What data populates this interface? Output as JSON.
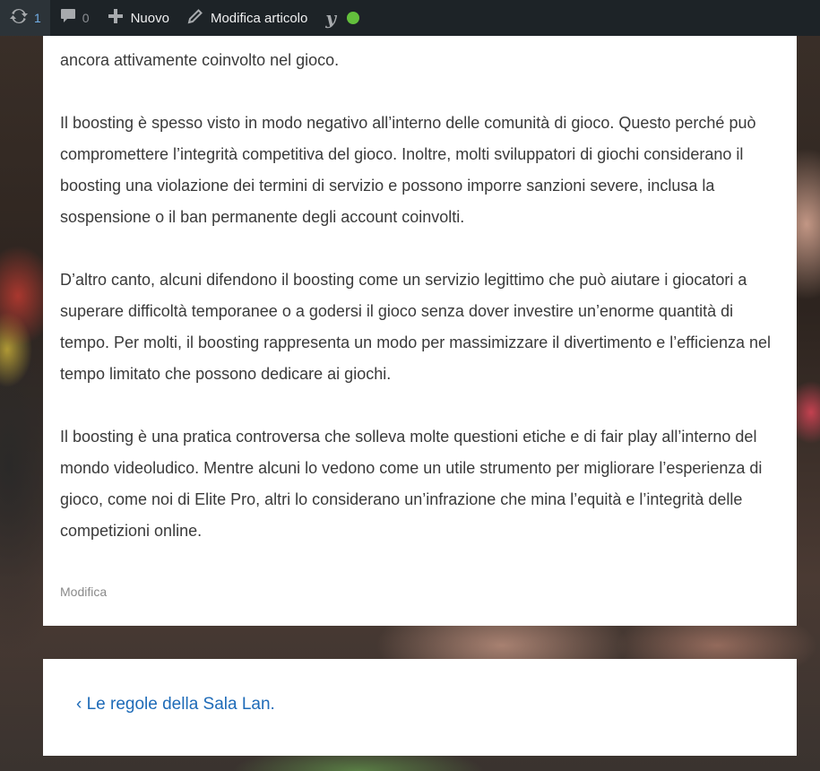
{
  "adminbar": {
    "updates_count": "1",
    "comments_count": "0",
    "new_label": "Nuovo",
    "edit_post_label": "Modifica articolo",
    "seo_status_color": "#63c03c"
  },
  "article": {
    "paragraphs": [
      "ancora attivamente coinvolto nel gioco.",
      "Il boosting è spesso visto in modo negativo all’interno delle comunità di gioco. Questo perché può compromettere l’integrità competitiva del gioco. Inoltre, molti sviluppatori di giochi considerano il boosting una violazione dei termini di servizio e possono imporre sanzioni severe, inclusa la sospensione o il ban permanente degli account coinvolti.",
      "D’altro canto, alcuni difendono il boosting come un servizio legittimo che può aiutare i giocatori a superare difficoltà temporanee o a godersi il gioco senza dover investire un’enorme quantità di tempo. Per molti, il boosting rappresenta un modo per massimizzare il divertimento e l’efficienza nel tempo limitato che possono dedicare ai giochi.",
      "Il boosting è una pratica controversa che solleva molte questioni etiche e di fair play all’interno del mondo videoludico. Mentre alcuni lo vedono come un utile strumento per migliorare l’esperienza di gioco, come noi di Elite Pro, altri lo considerano un’infrazione che mina l’equità e l’integrità delle competizioni online."
    ],
    "edit_label": "Modifica"
  },
  "post_nav": {
    "previous_label": "‹ Le regole della Sala Lan."
  }
}
